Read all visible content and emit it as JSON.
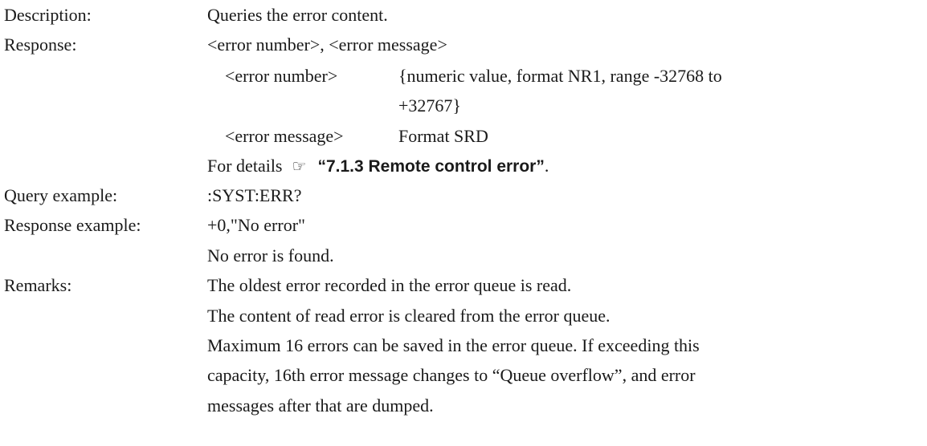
{
  "description": {
    "label": "Description:",
    "text": "Queries the error content."
  },
  "response": {
    "label": "Response:",
    "text": "<error number>, <error message>",
    "params": [
      {
        "name": "<error number>",
        "text_line1": "{numeric value, format NR1, range -32768 to",
        "text_line2": "+32767}"
      },
      {
        "name": "<error message>",
        "text_line1": "Format SRD"
      }
    ],
    "details_prefix": "For details",
    "details_icon": "pointing-hand-icon",
    "details_ref": "“7.1.3 Remote control error”",
    "details_suffix": "."
  },
  "query_example": {
    "label": "Query example:",
    "text": ":SYST:ERR?"
  },
  "response_example": {
    "label": "Response example:",
    "text": "+0,\"No error\"",
    "note": "No error is found."
  },
  "remarks": {
    "label": "Remarks:",
    "lines": [
      "The oldest error recorded in the error queue is read.",
      "The content of read error is cleared from the error queue.",
      "Maximum 16 errors can be saved in the error queue. If exceeding this",
      "capacity, 16th error message changes to “Queue overflow”, and error",
      "messages after that are dumped."
    ]
  }
}
